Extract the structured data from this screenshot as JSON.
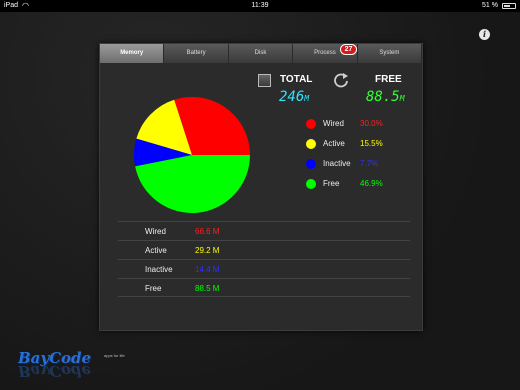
{
  "statusbar": {
    "device": "iPad",
    "wifi_icon": "wifi-icon",
    "time": "11:39",
    "battery": "51 %"
  },
  "tabs": [
    {
      "label": "Memory",
      "active": true
    },
    {
      "label": "Battery",
      "active": false
    },
    {
      "label": "Disk",
      "active": false
    },
    {
      "label": "Process",
      "active": false
    },
    {
      "label": "System",
      "active": false
    }
  ],
  "process_badge": "27",
  "summary": {
    "total_label": "TOTAL",
    "free_label": "FREE",
    "total_value": "246",
    "total_unit": "M",
    "free_value": "88.5",
    "free_unit": "M"
  },
  "colors": {
    "wired": "#ff0000",
    "active": "#ffff00",
    "inactive": "#0000ff",
    "free": "#00ff00"
  },
  "chart_data": {
    "type": "pie",
    "slices": [
      {
        "name": "Wired",
        "value": 30.0,
        "color": "#ff0000"
      },
      {
        "name": "Active",
        "value": 15.5,
        "color": "#ffff00"
      },
      {
        "name": "Inactive",
        "value": 7.7,
        "color": "#0000ff"
      },
      {
        "name": "Free",
        "value": 46.9,
        "color": "#00ff00"
      }
    ]
  },
  "legend": [
    {
      "name": "Wired",
      "pct": "30.0%",
      "color": "#ff0000"
    },
    {
      "name": "Active",
      "pct": "15.5%",
      "color": "#ffff00"
    },
    {
      "name": "Inactive",
      "pct": "7.7%",
      "color": "#0000ff"
    },
    {
      "name": "Free",
      "pct": "46.9%",
      "color": "#00ff00"
    }
  ],
  "table": [
    {
      "name": "Wired",
      "value": "66.6 M",
      "color": "#ff2020"
    },
    {
      "name": "Active",
      "value": "29.2 M",
      "color": "#ffff00"
    },
    {
      "name": "Inactive",
      "value": "14.4 M",
      "color": "#3030ff"
    },
    {
      "name": "Free",
      "value": "88.5 M",
      "color": "#00ff00"
    }
  ],
  "logo": {
    "text": "BayCode",
    "tagline": "apps for life"
  }
}
